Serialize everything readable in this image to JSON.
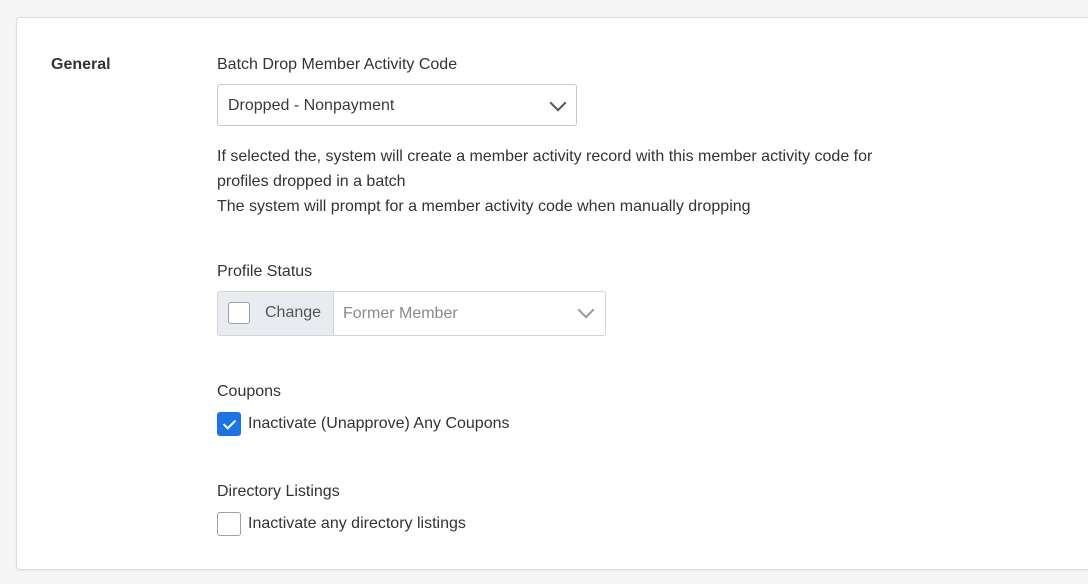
{
  "section": {
    "title": "General"
  },
  "batch_drop": {
    "label": "Batch Drop Member Activity Code",
    "selected": "Dropped - Nonpayment",
    "help_lines": [
      "If selected the, system will create a member activity record with this member activity code for",
      "profiles dropped in a batch",
      "The system will prompt for a member activity code when manually dropping"
    ]
  },
  "profile_status": {
    "label": "Profile Status",
    "change_label": "Change",
    "change_checked": false,
    "selected": "Former Member"
  },
  "coupons": {
    "label": "Coupons",
    "option_label": "Inactivate (Unapprove) Any Coupons",
    "checked": true
  },
  "directory_listings": {
    "label": "Directory Listings",
    "option_label": "Inactivate any directory listings",
    "checked": false
  },
  "colors": {
    "accent": "#1a73e8",
    "addon_bg": "#e8ebef"
  },
  "icons": {
    "select_arrow": "chevron-down-icon",
    "check": "checkmark-icon"
  }
}
